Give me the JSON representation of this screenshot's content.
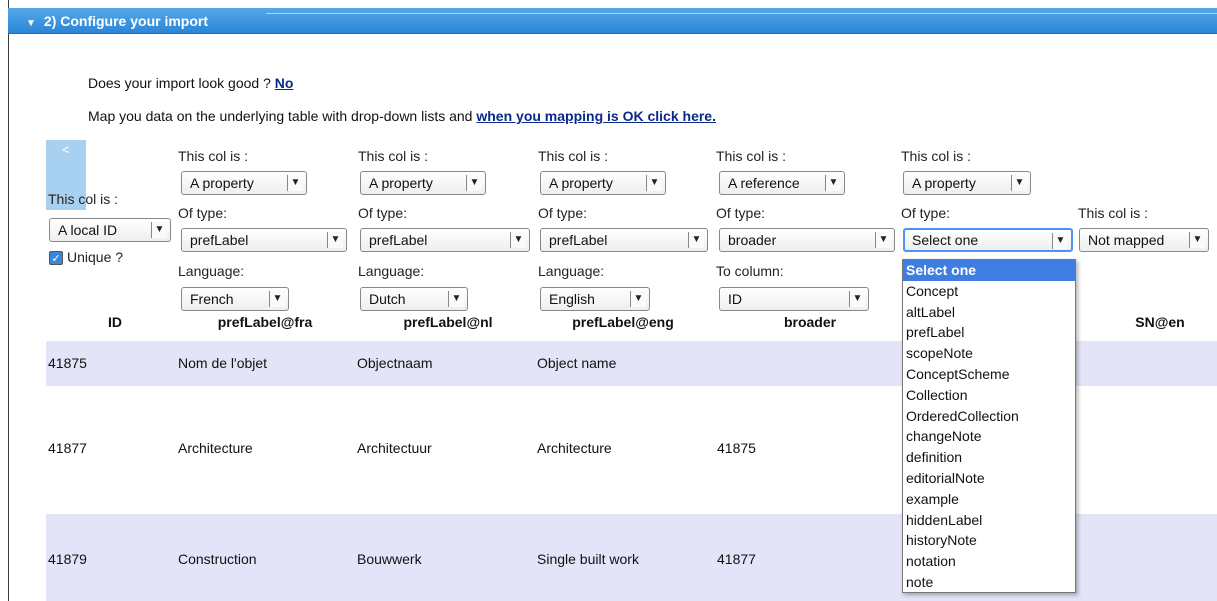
{
  "header": {
    "title": "2) Configure your import",
    "toggle_icon": "triangle-down-icon"
  },
  "intro": {
    "question": "Does your import look good ?",
    "no_link": "No",
    "mapping_text": "Map you data on the underlying table with drop-down lists and",
    "ok_link": "when you mapping is OK click here."
  },
  "nav": {
    "prev_label": "<"
  },
  "columns": [
    {
      "this_col_label": "This col is :",
      "role": "A local ID",
      "unique_label": "Unique ?",
      "unique_checked": true,
      "header": "ID"
    },
    {
      "this_col_label": "This col is :",
      "role": "A property",
      "of_type_label": "Of type:",
      "type": "prefLabel",
      "lang_label": "Language:",
      "lang": "French",
      "header": "prefLabel@fra"
    },
    {
      "this_col_label": "This col is :",
      "role": "A property",
      "of_type_label": "Of type:",
      "type": "prefLabel",
      "lang_label": "Language:",
      "lang": "Dutch",
      "header": "prefLabel@nl"
    },
    {
      "this_col_label": "This col is :",
      "role": "A property",
      "of_type_label": "Of type:",
      "type": "prefLabel",
      "lang_label": "Language:",
      "lang": "English",
      "header": "prefLabel@eng"
    },
    {
      "this_col_label": "This col is :",
      "role": "A reference",
      "of_type_label": "Of type:",
      "type": "broader",
      "to_col_label": "To column:",
      "to_col": "ID",
      "header": "broader"
    },
    {
      "this_col_label": "This col is :",
      "role": "A property",
      "of_type_label": "Of type:",
      "type": "Select one",
      "header": ""
    },
    {
      "this_col_label": "This col is :",
      "role": "Not mapped",
      "header": "SN@en"
    }
  ],
  "dropdown": {
    "options": [
      "Select one",
      "Concept",
      "altLabel",
      "prefLabel",
      "scopeNote",
      "ConceptScheme",
      "Collection",
      "OrderedCollection",
      "changeNote",
      "definition",
      "editorialNote",
      "example",
      "hiddenLabel",
      "historyNote",
      "notation",
      "note"
    ],
    "selected_index": 0
  },
  "rows": [
    {
      "id": "41875",
      "fra": "Nom de l'objet",
      "nl": "Objectnaam",
      "eng": "Object name",
      "broader": ""
    },
    {
      "id": "41877",
      "fra": "Architecture",
      "nl": "Architectuur",
      "eng": "Architecture",
      "broader": "41875"
    },
    {
      "id": "41879",
      "fra": "Construction",
      "nl": "Bouwwerk",
      "eng": "Single built work",
      "broader": "41877"
    }
  ],
  "colors": {
    "header_blue": "#2a86d8",
    "row_alt": "#e4e4f8",
    "link": "#0a2a8a",
    "selected": "#3f7ee0"
  }
}
